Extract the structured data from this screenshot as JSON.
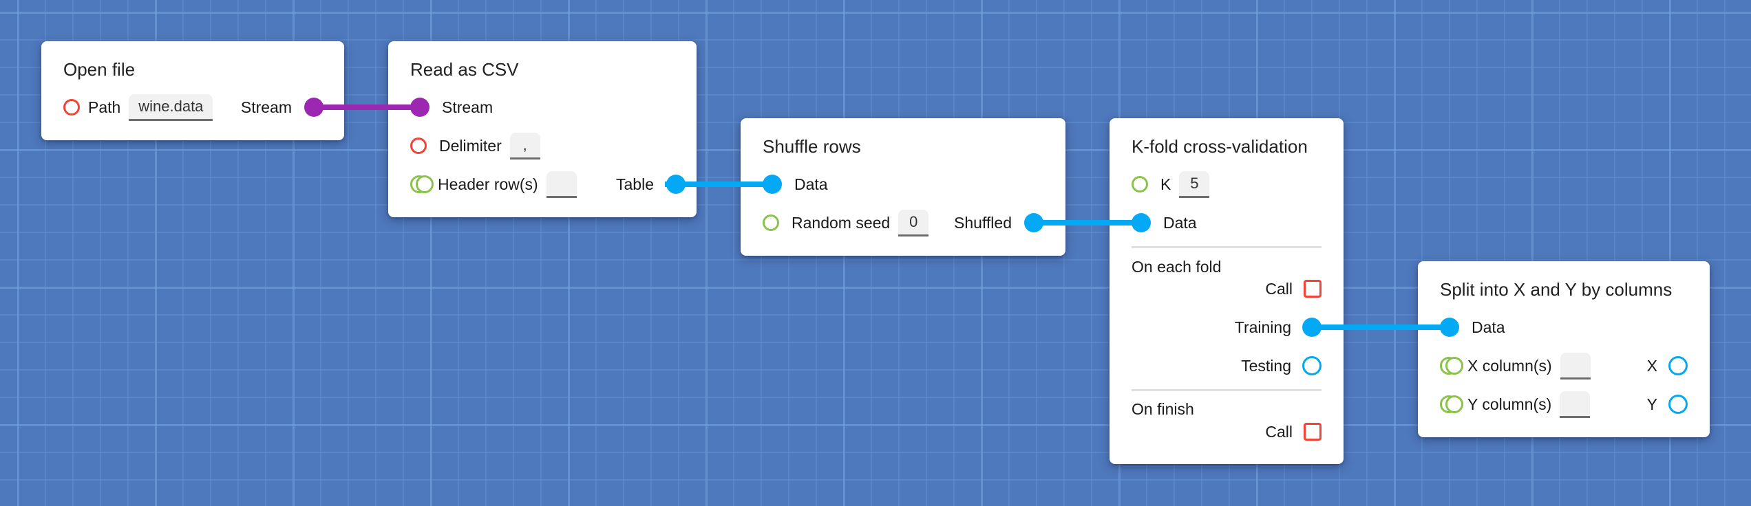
{
  "colors": {
    "background": "#4f79bd",
    "stream_socket": "#9c27b0",
    "data_socket": "#03a9f4",
    "required_input": "#f44336",
    "optional_input": "#8bc34a",
    "event_trigger": "#f44336"
  },
  "nodes": {
    "open_file": {
      "title": "Open file",
      "path_label": "Path",
      "path_value": "wine.data",
      "stream_output": "Stream"
    },
    "read_csv": {
      "title": "Read as CSV",
      "stream_input": "Stream",
      "delimiter_label": "Delimiter",
      "delimiter_value": ",",
      "header_label": "Header row(s)",
      "header_value": "",
      "table_output": "Table"
    },
    "shuffle": {
      "title": "Shuffle rows",
      "data_input": "Data",
      "seed_label": "Random seed",
      "seed_value": "0",
      "shuffled_output": "Shuffled"
    },
    "kfold": {
      "title": "K-fold cross-validation",
      "k_label": "K",
      "k_value": "5",
      "data_input": "Data",
      "on_each_fold": "On each fold",
      "call_label_1": "Call",
      "training_output": "Training",
      "testing_output": "Testing",
      "on_finish": "On finish",
      "call_label_2": "Call"
    },
    "split": {
      "title": "Split into X and Y by columns",
      "data_input": "Data",
      "x_cols_label": "X column(s)",
      "x_cols_value": "",
      "x_output": "X",
      "y_cols_label": "Y column(s)",
      "y_cols_value": "",
      "y_output": "Y"
    }
  },
  "connections": [
    {
      "from": "open_file.Stream",
      "to": "read_csv.Stream",
      "type": "stream"
    },
    {
      "from": "read_csv.Table",
      "to": "shuffle.Data",
      "type": "data"
    },
    {
      "from": "shuffle.Shuffled",
      "to": "kfold.Data",
      "type": "data"
    },
    {
      "from": "kfold.Training",
      "to": "split.Data",
      "type": "data"
    }
  ]
}
